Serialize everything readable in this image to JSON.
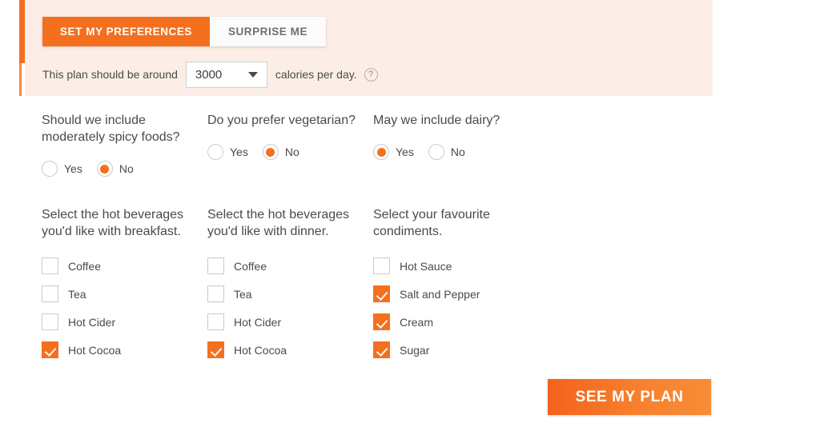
{
  "accent_color": "#F4701F",
  "panel_color": "#FCEEE6",
  "text_color": "#4A4A4A",
  "tabs": [
    {
      "label": "SET MY PREFERENCES",
      "active": true
    },
    {
      "label": "SURPRISE ME",
      "active": false
    }
  ],
  "calories": {
    "prefix_label": "This plan should be around",
    "selected_value": "3000",
    "suffix_label": "calories per day.",
    "help_icon": "question-mark-icon",
    "help_glyph": "?",
    "caret_icon": "chevron-down-icon"
  },
  "questions": {
    "spicy": {
      "title": "Should we include moderately spicy foods?",
      "options": [
        {
          "label": "Yes",
          "selected": false
        },
        {
          "label": "No",
          "selected": true
        }
      ]
    },
    "vegetarian": {
      "title": "Do you prefer vegetarian?",
      "options": [
        {
          "label": "Yes",
          "selected": false
        },
        {
          "label": "No",
          "selected": true
        }
      ]
    },
    "dairy": {
      "title": "May we include dairy?",
      "options": [
        {
          "label": "Yes",
          "selected": true
        },
        {
          "label": "No",
          "selected": false
        }
      ]
    },
    "breakfast_beverages": {
      "title": "Select the hot beverages you'd like with breakfast.",
      "options": [
        {
          "label": "Coffee",
          "checked": false
        },
        {
          "label": "Tea",
          "checked": false
        },
        {
          "label": "Hot Cider",
          "checked": false
        },
        {
          "label": "Hot Cocoa",
          "checked": true
        }
      ]
    },
    "dinner_beverages": {
      "title": "Select the hot beverages you'd like with dinner.",
      "options": [
        {
          "label": "Coffee",
          "checked": false
        },
        {
          "label": "Tea",
          "checked": false
        },
        {
          "label": "Hot Cider",
          "checked": false
        },
        {
          "label": "Hot Cocoa",
          "checked": true
        }
      ]
    },
    "condiments": {
      "title": "Select your favourite condiments.",
      "options": [
        {
          "label": "Hot Sauce",
          "checked": false
        },
        {
          "label": "Salt and Pepper",
          "checked": true
        },
        {
          "label": "Cream",
          "checked": true
        },
        {
          "label": "Sugar",
          "checked": true
        }
      ]
    }
  },
  "cta": {
    "label": "SEE MY PLAN"
  }
}
